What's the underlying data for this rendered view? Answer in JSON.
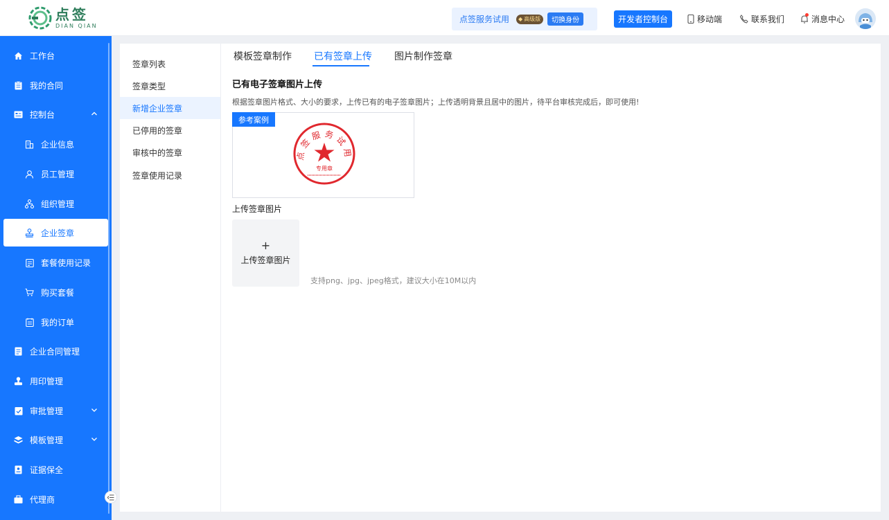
{
  "header": {
    "logo_cn": "点签",
    "logo_en": "DIAN QIAN",
    "trial_name": "点签服务试用",
    "vip_label": "高级版",
    "switch_identity": "切换身份",
    "developer_console": "开发者控制台",
    "mobile": "移动端",
    "contact": "联系我们",
    "messages": "消息中心"
  },
  "sidebar": {
    "items": [
      {
        "label": "工作台",
        "icon": "home-icon"
      },
      {
        "label": "我的合同",
        "icon": "contract-icon"
      },
      {
        "label": "控制台",
        "icon": "console-icon",
        "expanded": true
      },
      {
        "label": "企业信息",
        "icon": "building-icon"
      },
      {
        "label": "员工管理",
        "icon": "user-icon"
      },
      {
        "label": "组织管理",
        "icon": "org-icon"
      },
      {
        "label": "企业签章",
        "icon": "stamp-icon",
        "active": true
      },
      {
        "label": "套餐使用记录",
        "icon": "record-icon"
      },
      {
        "label": "购买套餐",
        "icon": "cart-icon"
      },
      {
        "label": "我的订单",
        "icon": "order-icon"
      },
      {
        "label": "企业合同管理",
        "icon": "doc-icon"
      },
      {
        "label": "用印管理",
        "icon": "seal-use-icon"
      },
      {
        "label": "审批管理",
        "icon": "approve-icon"
      },
      {
        "label": "模板管理",
        "icon": "layers-icon"
      },
      {
        "label": "证据保全",
        "icon": "evidence-icon"
      },
      {
        "label": "代理商",
        "icon": "agent-icon"
      }
    ]
  },
  "subnav": {
    "items": [
      "签章列表",
      "签章类型",
      "新增企业签章",
      "已停用的签章",
      "审核中的签章",
      "签章使用记录"
    ],
    "active_index": 2
  },
  "tabs": {
    "items": [
      "模板签章制作",
      "已有签章上传",
      "图片制作签章"
    ],
    "active_index": 1
  },
  "content": {
    "title": "已有电子签章图片上传",
    "description": "根据签章图片格式、大小的要求，上传已有的电子签章图片；上传透明背景且居中的图片，待平台审核完成后，即可使用!",
    "sample_tag": "参考案例",
    "seal_top_text": "点签服务试用",
    "seal_bottom_text": "专用章",
    "upload_label": "上传签章图片",
    "upload_plus": "+",
    "upload_button": "上传签章图片",
    "upload_hint": "支持png、jpg、jpeg格式，建议大小在10M以内"
  },
  "colors": {
    "primary": "#1777ff",
    "sidebar_bg": "#1777ff",
    "seal_red": "#e0282e",
    "brand_green": "#2e7d5b"
  }
}
